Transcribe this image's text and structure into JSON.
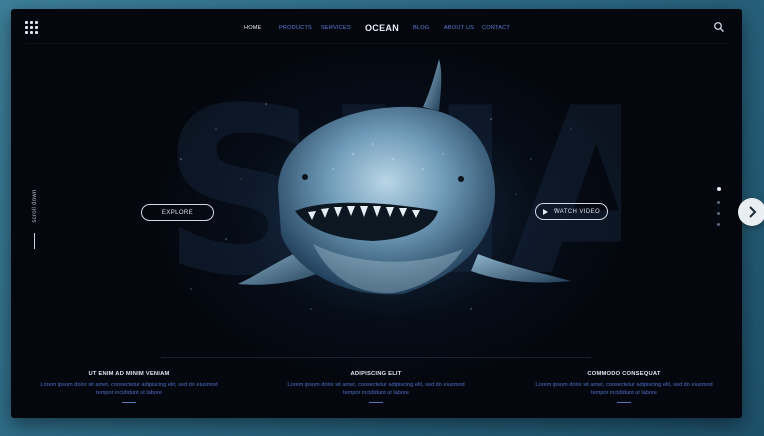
{
  "nav": {
    "items": [
      {
        "label": "HOME",
        "active": true
      },
      {
        "label": "PRODUCTS",
        "active": false
      },
      {
        "label": "SERVICES",
        "active": false
      },
      {
        "label": "BLOG",
        "active": false
      },
      {
        "label": "ABOUT US",
        "active": false
      },
      {
        "label": "CONTACT",
        "active": false
      }
    ],
    "brand": "OCEAN",
    "menu_icon": "grid-menu-icon",
    "search_icon": "search-icon"
  },
  "hero": {
    "background_word": "SHARK",
    "scroll_label": "scroll down",
    "explore_label": "EXPLORE",
    "video_label": "WATCH VIDEO",
    "slider_count": 4,
    "slider_active": 1
  },
  "features": [
    {
      "title": "UT ENIM AD MINIM VENIAM",
      "line1": "Lorem ipsum dolor sit amet, consectetur adipiscing elit, sed do eiusmod",
      "line2": "tempor incididunt ut labore"
    },
    {
      "title": "ADIPISCING ELIT",
      "line1": "Lorem ipsum dolor sit amet, consectetur adipiscing elit, sed do eiusmod",
      "line2": "tempor incididunt ut labore"
    },
    {
      "title": "COMMODO CONSEQUAT",
      "line1": "Lorem ipsum dolor sit amet, consectetur adipiscing elit, sed do eiusmod",
      "line2": "tempor incididunt ut labore"
    }
  ],
  "colors": {
    "accent": "#5f7fd6",
    "background": "#04070d",
    "page": "#2b6782"
  }
}
